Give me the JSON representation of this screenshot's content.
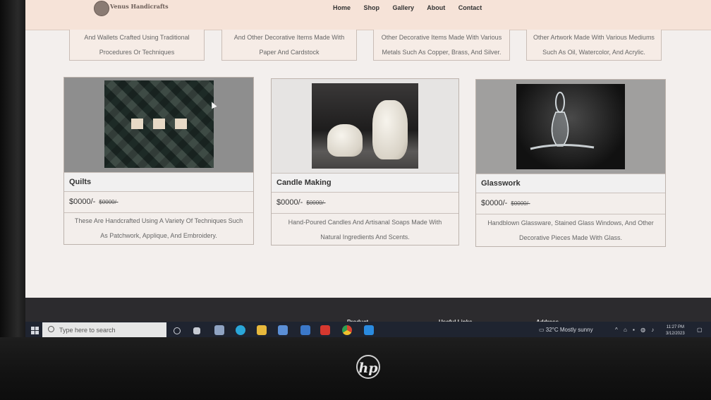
{
  "site": {
    "logo_text": "Venus Handicrafts",
    "nav": [
      "Home",
      "Shop",
      "Gallery",
      "About",
      "Contact"
    ]
  },
  "top_cards": [
    {
      "line1": "And Wallets Crafted Using Traditional",
      "line2": "Procedures Or Techniques"
    },
    {
      "line1": "And Other Decorative Items Made With",
      "line2": "Paper And Cardstock"
    },
    {
      "line1": "Other Decorative Items Made With Various",
      "line2": "Metals Such As Copper, Brass, And Silver."
    },
    {
      "line1": "Other Artwork Made With Various Mediums",
      "line2": "Such As Oil, Watercolor, And Acrylic."
    }
  ],
  "products": [
    {
      "title": "Quilts",
      "price": "$0000/-",
      "old_price": "$0000/-",
      "desc_line1": "These Are Handcrafted Using A Variety Of Techniques Such",
      "desc_line2": "As Patchwork, Applique, And Embroidery."
    },
    {
      "title": "Candle Making",
      "price": "$0000/-",
      "old_price": "$0000/-",
      "desc_line1": "Hand-Poured Candles And Artisanal Soaps Made With",
      "desc_line2": "Natural Ingredients And Scents."
    },
    {
      "title": "Glasswork",
      "price": "$0000/-",
      "old_price": "$0000/-",
      "desc_line1": "Handblown Glassware, Stained Glass Windows, And Other",
      "desc_line2": "Decorative Pieces Made With Glass."
    }
  ],
  "footer": {
    "headings": [
      "Product",
      "Useful Links",
      "Address"
    ]
  },
  "taskbar": {
    "search_placeholder": "Type here to search",
    "weather": "32°C  Mostly sunny",
    "time": "11:27 PM",
    "date": "3/12/2023",
    "pinned_icons": [
      "task-view-icon",
      "widgets-icon",
      "file-manager-icon",
      "edge-icon",
      "file-explorer-icon",
      "store-icon",
      "mail-icon",
      "wps-office-icon",
      "chrome-icon",
      "vscode-icon"
    ]
  },
  "monitor": {
    "brand": "hp"
  }
}
